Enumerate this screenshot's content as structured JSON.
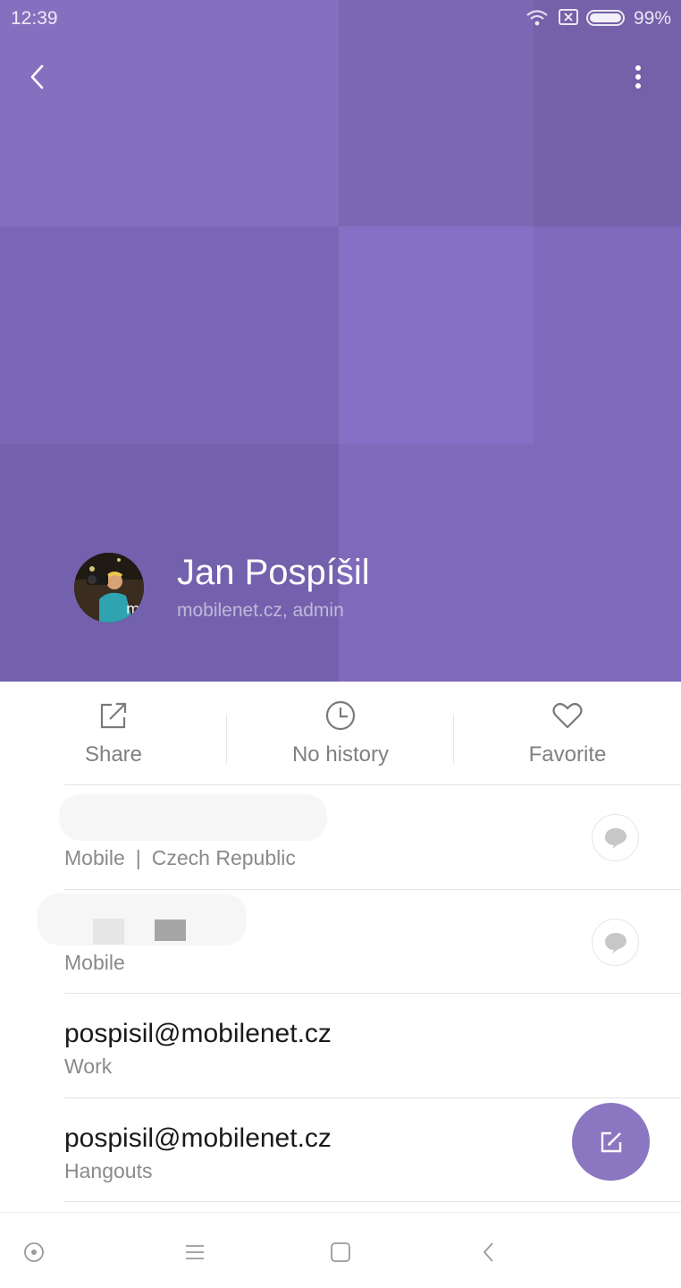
{
  "status_bar": {
    "time": "12:39",
    "battery": "99%"
  },
  "header": {
    "back_icon": "chevron-left-icon",
    "more_icon": "more-vertical-icon",
    "colors": {
      "primary": "#7d68b7"
    }
  },
  "contact": {
    "name": "Jan Pospíšil",
    "subtitle": "mobilenet.cz, admin"
  },
  "actions": [
    {
      "label": "Share",
      "icon": "share-icon"
    },
    {
      "label": "No history",
      "icon": "clock-icon"
    },
    {
      "label": "Favorite",
      "icon": "heart-icon"
    }
  ],
  "rows": [
    {
      "primary": "",
      "type": "Mobile",
      "region": "Czech Republic",
      "icon": "message-icon"
    },
    {
      "primary": "",
      "type": "Mobile",
      "icon": "message-icon"
    },
    {
      "primary": "pospisil@mobilenet.cz",
      "type": "Work"
    },
    {
      "primary": "pospisil@mobilenet.cz",
      "type": "Hangouts"
    }
  ],
  "fab": {
    "icon": "edit-icon",
    "color": "#8b77c1"
  },
  "nav_bar": [
    "record-icon",
    "menu-icon",
    "home-square-icon",
    "back-icon"
  ]
}
